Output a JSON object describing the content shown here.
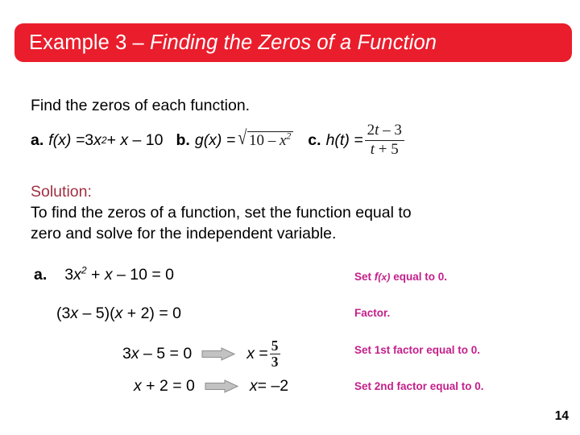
{
  "slide": {
    "title_prefix": "Example 3 – ",
    "title_emphasis": "Finding the Zeros of a Function",
    "banner_color": "#ea1d2c",
    "page_number": "14"
  },
  "prompt": {
    "text": "Find the zeros of each function."
  },
  "functions": [
    {
      "marker": "a.",
      "name": "f(x) = ",
      "expr_lead": "3",
      "expr_var": "x",
      "expr_exp": "2",
      "expr_tail": " + x – 10"
    },
    {
      "marker": "b.",
      "name": "g(x) = ",
      "radical_radicand_lead": "10 – ",
      "radical_radicand_var": "x",
      "radical_radicand_exp": "2",
      "radical_sign": "radical-icon"
    },
    {
      "marker": "c.",
      "name": "h(t) = ",
      "fraction_numerator_coef": "2",
      "fraction_numerator_var": "t",
      "fraction_numerator_tail": " – 3",
      "fraction_denominator_var": "t",
      "fraction_denominator_tail": " + 5"
    }
  ],
  "solution": {
    "label": "Solution:",
    "label_color": "#a03041",
    "body": "To find the zeros of a function, set the function equal to\nzero and solve for the independent variable."
  },
  "steps": [
    {
      "marker": "a.",
      "lhs_lead": "3",
      "lhs_var": "x",
      "lhs_exp": "2",
      "lhs_tail": " + x – 10 = 0",
      "note": "Set f(x) equal to 0.",
      "note_fn": "f",
      "note_pre": "Set ",
      "note_arg": "(x)",
      "note_post": " equal to 0."
    },
    {
      "equation": "(3x – 5)(x + 2) = 0",
      "note": "Factor."
    },
    {
      "equation": "3x – 5 = 0",
      "arrow": "block-arrow-right-icon",
      "result_lead": "x = ",
      "result_numerator": "5",
      "result_denominator": "3",
      "note": "Set 1st factor equal to 0."
    },
    {
      "equation": "x + 2 = 0",
      "arrow": "block-arrow-right-icon",
      "result": "x = –2",
      "note": "Set 2nd factor equal to 0."
    }
  ],
  "notes_color": "#c41f8b"
}
